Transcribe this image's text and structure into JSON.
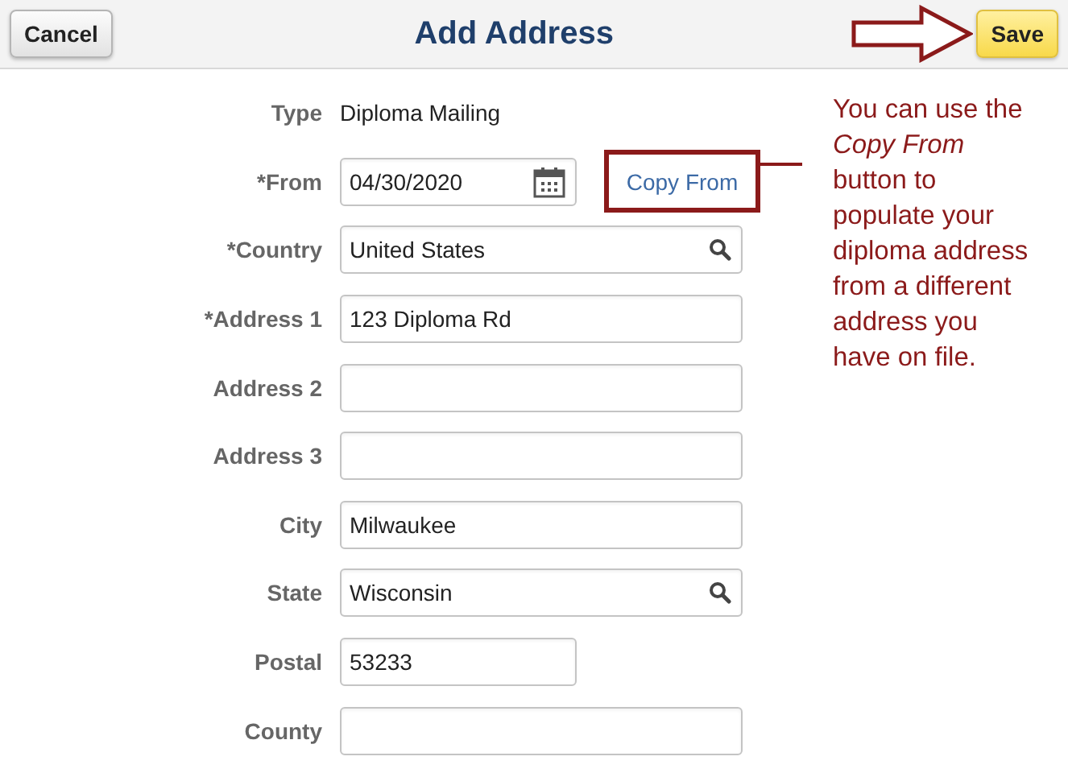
{
  "header": {
    "cancel": "Cancel",
    "title": "Add Address",
    "save": "Save"
  },
  "fields": [
    {
      "label": "Type",
      "kind": "display",
      "value": "Diploma Mailing"
    },
    {
      "label": "*From",
      "kind": "date",
      "value": "04/30/2020"
    },
    {
      "label": "*Country",
      "kind": "lookup",
      "value": "United States"
    },
    {
      "label": "*Address 1",
      "kind": "text",
      "value": "123 Diploma Rd"
    },
    {
      "label": "Address 2",
      "kind": "text"
    },
    {
      "label": "Address 3",
      "kind": "text"
    },
    {
      "label": "City",
      "kind": "text",
      "value": "Milwaukee"
    },
    {
      "label": "State",
      "kind": "lookup",
      "value": "Wisconsin"
    },
    {
      "label": "Postal",
      "kind": "short",
      "value": "53233"
    },
    {
      "label": "County",
      "kind": "text"
    }
  ],
  "copy_from": "Copy From",
  "callout": "You can use the *Copy From* button to populate your diploma address from a different address you have on file."
}
